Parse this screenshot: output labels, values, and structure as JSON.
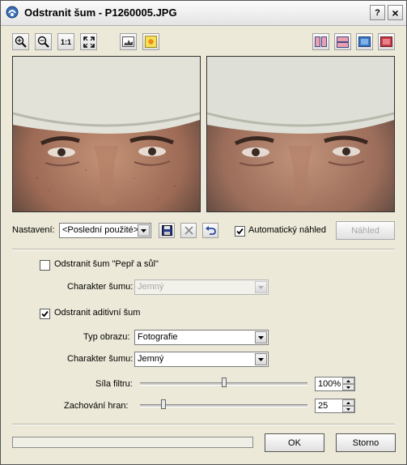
{
  "window": {
    "title": "Odstranit šum - P1260005.JPG"
  },
  "titlebar_buttons": {
    "help": "?",
    "close": "×"
  },
  "toolbar": {
    "zoom_1to1_label": "1:1",
    "left_tools": [
      "zoom-in-icon",
      "zoom-out-icon",
      "actual-size-icon",
      "fit-screen-icon",
      "histogram-icon",
      "sun-icon"
    ],
    "right_tools": [
      "split-vertical-icon",
      "split-horizontal-icon",
      "single-view-icon",
      "original-view-icon"
    ]
  },
  "settings": {
    "label": "Nastavení:",
    "preset_value": "<Poslední použité>",
    "auto_preview_label": "Automatický náhled",
    "auto_preview_checked": true,
    "preview_button": "Náhled"
  },
  "salt_pepper": {
    "checkbox_label": "Odstranit šum \"Pepř a sůl\"",
    "checked": false,
    "noise_char_label": "Charakter šumu:",
    "noise_char_value": "Jemný"
  },
  "additive": {
    "checkbox_label": "Odstranit aditivní šum",
    "checked": true,
    "image_type_label": "Typ obrazu:",
    "image_type_value": "Fotografie",
    "noise_char_label": "Charakter šumu:",
    "noise_char_value": "Jemný"
  },
  "filter_strength": {
    "label": "Síla filtru:",
    "value": "100%",
    "level": 0.5
  },
  "edge_preserve": {
    "label": "Zachování hran:",
    "value": "25",
    "level": 0.14
  },
  "progress": {
    "fraction": 0
  },
  "buttons": {
    "ok": "OK",
    "cancel": "Storno"
  },
  "colors": {
    "dialog_bg": "#ece9d8",
    "check": "#000000"
  }
}
